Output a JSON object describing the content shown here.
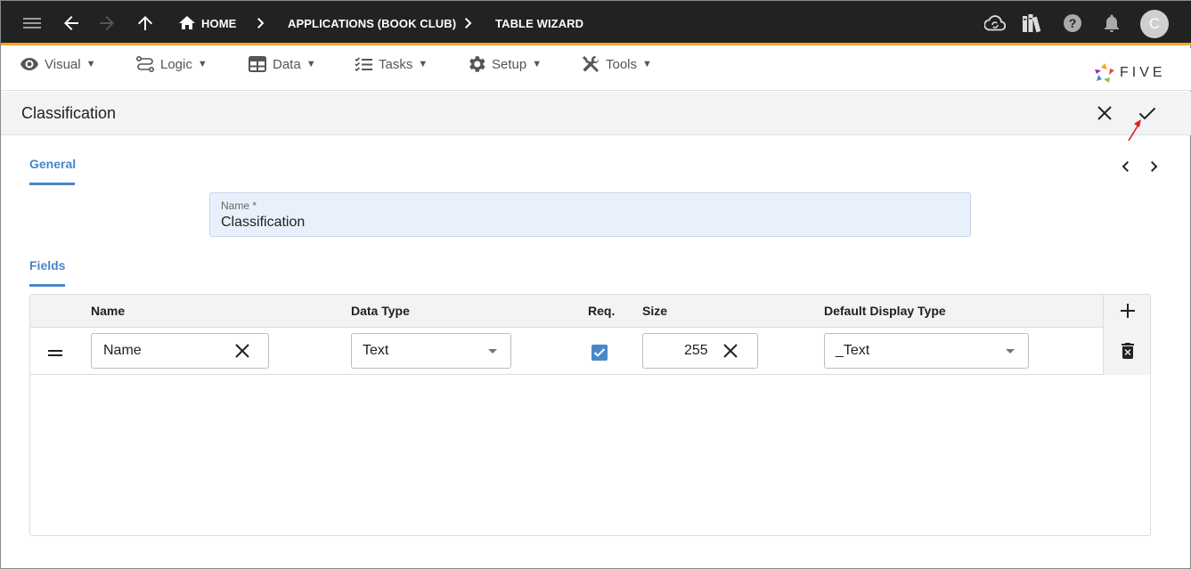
{
  "topbar": {
    "crumbs": [
      "HOME",
      "APPLICATIONS (BOOK CLUB)",
      "TABLE WIZARD"
    ],
    "avatar_letter": "C",
    "accent_color": "#f5a623",
    "icons": [
      "menu-icon",
      "back-arrow-icon",
      "forward-arrow-icon",
      "up-arrow-icon",
      "home-icon",
      "cloud-sync-icon",
      "library-icon",
      "help-icon",
      "bell-icon"
    ]
  },
  "menu": {
    "items": [
      {
        "label": "Visual",
        "icon": "eye-icon"
      },
      {
        "label": "Logic",
        "icon": "flow-icon"
      },
      {
        "label": "Data",
        "icon": "table-icon"
      },
      {
        "label": "Tasks",
        "icon": "checklist-icon"
      },
      {
        "label": "Setup",
        "icon": "gear-icon"
      },
      {
        "label": "Tools",
        "icon": "wrench-icon"
      }
    ],
    "caret": "▼",
    "logo_text": "FIVE"
  },
  "form": {
    "title": "Classification",
    "tabs": {
      "general": "General",
      "fields": "Fields"
    },
    "name_label": "Name *",
    "name_value": "Classification"
  },
  "grid": {
    "columns": [
      "Name",
      "Data Type",
      "Req.",
      "Size",
      "Default Display Type"
    ],
    "rows": [
      {
        "name": "Name",
        "data_type": "Text",
        "required": true,
        "size": "255",
        "display_type": "_Text"
      }
    ]
  },
  "colors": {
    "primary": "#4a86c8",
    "topbar_bg": "#222222",
    "header_bg": "#f2f3f4"
  }
}
